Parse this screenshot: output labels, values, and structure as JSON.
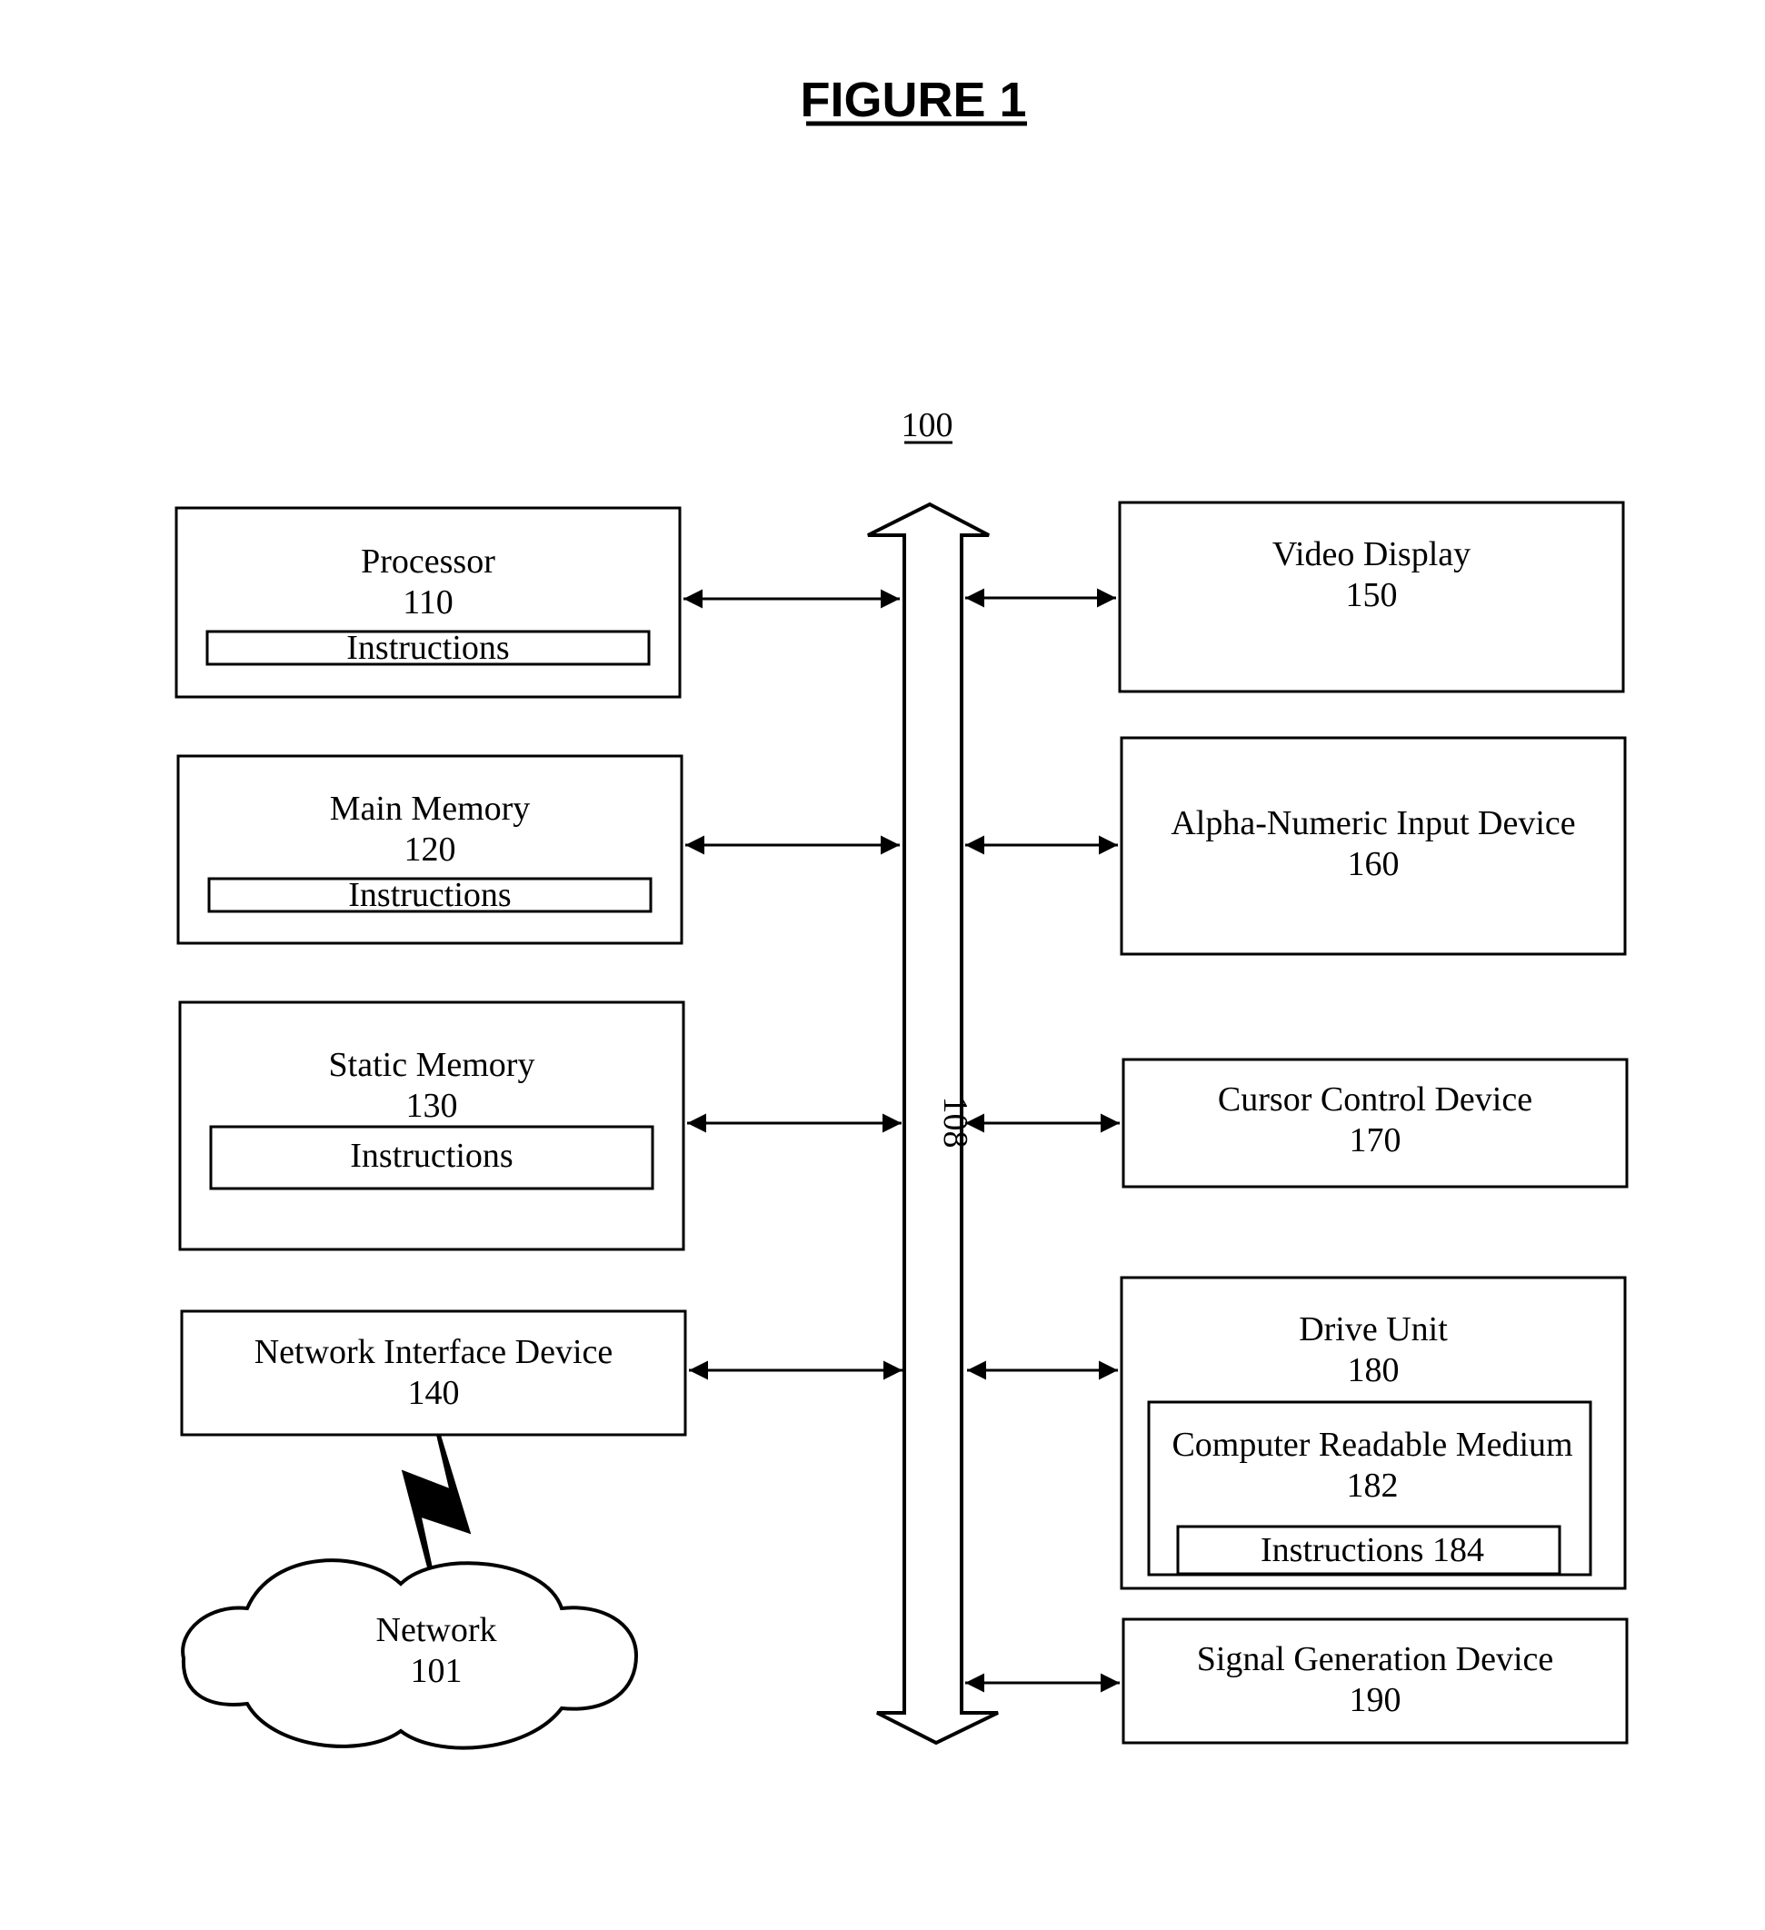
{
  "figure": {
    "title": "FIGURE 1",
    "system_ref": "100",
    "bus_ref": "108"
  },
  "left_components": [
    {
      "name": "Processor",
      "ref": "110",
      "sub": "Instructions"
    },
    {
      "name": "Main Memory",
      "ref": "120",
      "sub": "Instructions"
    },
    {
      "name": "Static Memory",
      "ref": "130",
      "sub": "Instructions"
    },
    {
      "name": "Network Interface Device",
      "ref": "140"
    }
  ],
  "right_components": [
    {
      "name": "Video Display",
      "ref": "150"
    },
    {
      "name": "Alpha-Numeric Input Device",
      "ref": "160"
    },
    {
      "name": "Cursor Control Device",
      "ref": "170"
    },
    {
      "name": "Drive Unit",
      "ref": "180",
      "medium": {
        "name": "Computer Readable Medium",
        "ref": "182",
        "sub": "Instructions 184"
      }
    },
    {
      "name": "Signal Generation Device",
      "ref": "190"
    }
  ],
  "network": {
    "name": "Network",
    "ref": "101"
  }
}
